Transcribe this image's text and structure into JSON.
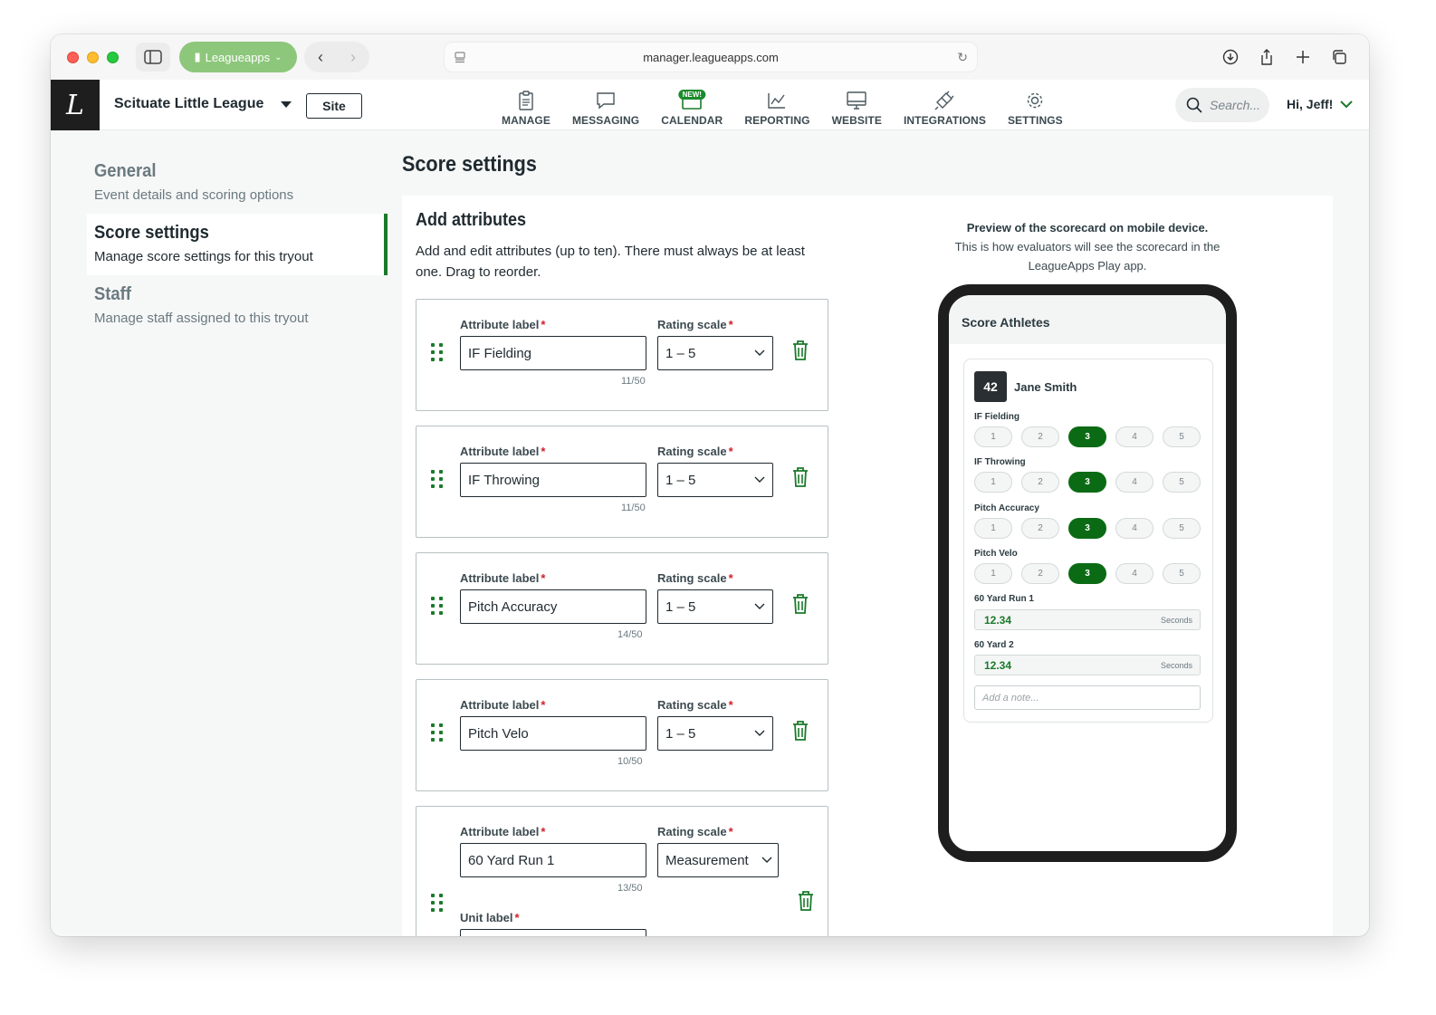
{
  "browser": {
    "profile_label": "Leagueapps",
    "url": "manager.leagueapps.com"
  },
  "header": {
    "org_name": "Scituate Little League",
    "site_button": "Site",
    "nav": [
      {
        "label": "MANAGE",
        "icon": "clipboard-icon"
      },
      {
        "label": "MESSAGING",
        "icon": "chat-icon"
      },
      {
        "label": "CALENDAR",
        "icon": "calendar-icon",
        "badge": "NEW!"
      },
      {
        "label": "REPORTING",
        "icon": "chart-icon"
      },
      {
        "label": "WEBSITE",
        "icon": "monitor-icon"
      },
      {
        "label": "INTEGRATIONS",
        "icon": "plug-icon"
      },
      {
        "label": "SETTINGS",
        "icon": "gear-icon"
      }
    ],
    "search_placeholder": "Search...",
    "greeting": "Hi, Jeff!"
  },
  "sidebar": {
    "items": [
      {
        "title": "General",
        "subtitle": "Event details and scoring options",
        "active": false
      },
      {
        "title": "Score settings",
        "subtitle": "Manage score settings for this tryout",
        "active": true
      },
      {
        "title": "Staff",
        "subtitle": "Manage staff assigned to this tryout",
        "active": false
      }
    ]
  },
  "page": {
    "title": "Score settings",
    "section_title": "Add attributes",
    "section_desc": "Add and edit attributes (up to ten). There must always be at least one. Drag to reorder.",
    "attribute_label": "Attribute label",
    "rating_scale_label": "Rating scale",
    "unit_label": "Unit label",
    "required_mark": "*",
    "attributes": [
      {
        "label": "IF Fielding",
        "count": "11/50",
        "scale": "1 – 5"
      },
      {
        "label": "IF Throwing",
        "count": "11/50",
        "scale": "1 – 5"
      },
      {
        "label": "Pitch Accuracy",
        "count": "14/50",
        "scale": "1 – 5"
      },
      {
        "label": "Pitch Velo",
        "count": "10/50",
        "scale": "1 – 5"
      },
      {
        "label": "60 Yard Run 1",
        "count": "13/50",
        "scale": "Measurement"
      }
    ]
  },
  "preview": {
    "caption_bold": "Preview of the scorecard on mobile device.",
    "caption": "This is how evaluators will see the scorecard in the LeagueApps Play app.",
    "screen_title": "Score Athletes",
    "jersey": "42",
    "player": "Jane Smith",
    "ratings": [
      {
        "label": "IF Fielding",
        "options": [
          "1",
          "2",
          "3",
          "4",
          "5"
        ],
        "selected": "3"
      },
      {
        "label": "IF Throwing",
        "options": [
          "1",
          "2",
          "3",
          "4",
          "5"
        ],
        "selected": "3"
      },
      {
        "label": "Pitch Accuracy",
        "options": [
          "1",
          "2",
          "3",
          "4",
          "5"
        ],
        "selected": "3"
      },
      {
        "label": "Pitch Velo",
        "options": [
          "1",
          "2",
          "3",
          "4",
          "5"
        ],
        "selected": "3"
      }
    ],
    "measurements": [
      {
        "label": "60 Yard Run 1",
        "value": "12.34",
        "unit": "Seconds"
      },
      {
        "label": "60 Yard 2",
        "value": "12.34",
        "unit": "Seconds"
      }
    ],
    "note_placeholder": "Add a note..."
  },
  "colors": {
    "accent_green": "#1a7a2a",
    "selected_pill": "#0b6b14",
    "required_red": "#d1202a",
    "profile_green": "#8dc77b"
  }
}
